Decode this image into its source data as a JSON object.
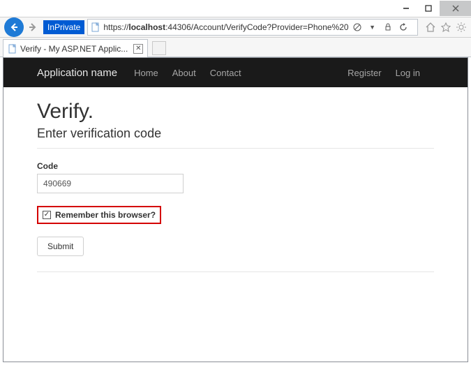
{
  "window": {
    "minimize": "–",
    "maximize": "▢",
    "close": "×"
  },
  "browser": {
    "inprivate_label": "InPrivate",
    "url_prefix": "https://",
    "url_host": "localhost",
    "url_rest": ":44306/Account/VerifyCode?Provider=Phone%20",
    "tab_title": "Verify - My ASP.NET Applic..."
  },
  "navbar": {
    "brand": "Application name",
    "home": "Home",
    "about": "About",
    "contact": "Contact",
    "register": "Register",
    "login": "Log in"
  },
  "page": {
    "heading": "Verify.",
    "subtitle": "Enter verification code",
    "code_label": "Code",
    "code_value": "490669",
    "remember_label": "Remember this browser?",
    "remember_checked": "✓",
    "submit_label": "Submit"
  }
}
